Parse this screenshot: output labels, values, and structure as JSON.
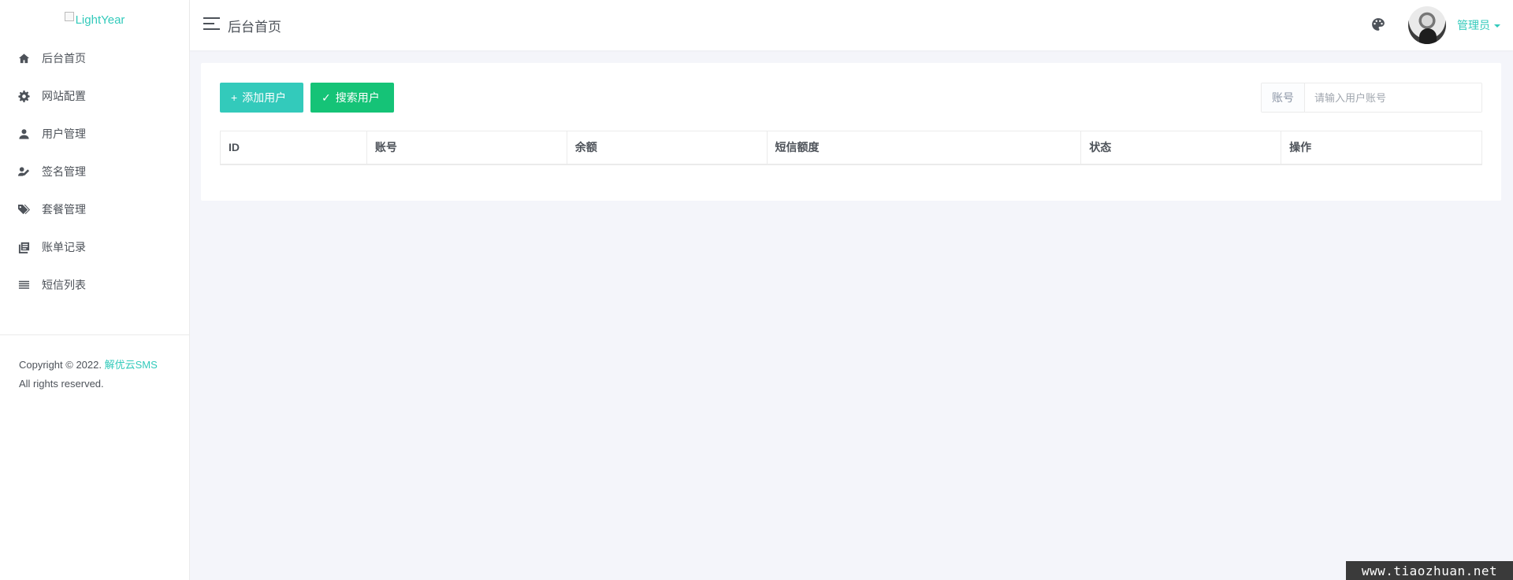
{
  "sidebar": {
    "logo_text": "LightYear",
    "items": [
      {
        "label": "后台首页",
        "icon": "home-icon"
      },
      {
        "label": "网站配置",
        "icon": "gear-icon"
      },
      {
        "label": "用户管理",
        "icon": "user-icon"
      },
      {
        "label": "签名管理",
        "icon": "signature-icon"
      },
      {
        "label": "套餐管理",
        "icon": "tags-icon"
      },
      {
        "label": "账单记录",
        "icon": "bill-icon"
      },
      {
        "label": "短信列表",
        "icon": "list-icon"
      }
    ],
    "copyright": {
      "prefix": "Copyright © 2022.",
      "link": "解优云SMS",
      "rights": "All rights reserved."
    }
  },
  "header": {
    "title": "后台首页",
    "user_name": "管理员"
  },
  "toolbar": {
    "add_label": "添加用户",
    "add_icon": "+",
    "search_label": "搜索用户",
    "search_icon": "✓"
  },
  "search": {
    "addon_label": "账号",
    "placeholder": "请输入用户账号",
    "value": ""
  },
  "table": {
    "columns": [
      "ID",
      "账号",
      "余额",
      "短信额度",
      "状态",
      "操作"
    ],
    "rows": []
  },
  "watermark": "www.tiaozhuan.net",
  "colors": {
    "accent": "#33cabb",
    "success": "#15c377",
    "text": "#4d5259",
    "background": "#f4f5fa"
  }
}
